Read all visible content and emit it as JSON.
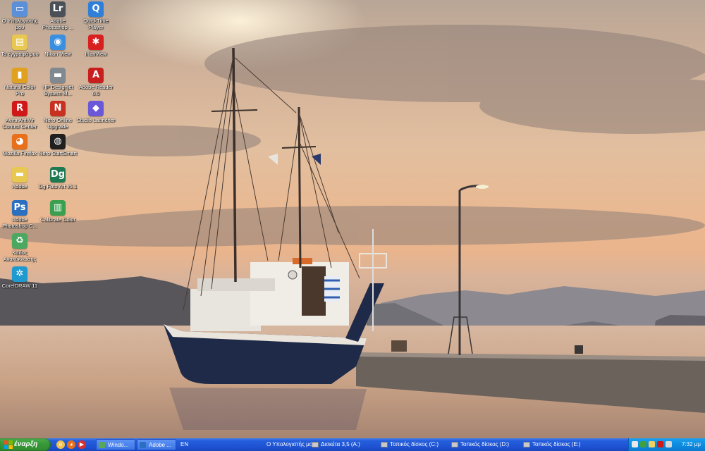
{
  "desktop": {
    "icons": [
      {
        "label": "Ο Υπολογιστής μου",
        "icon": "my-computer-icon",
        "color": "#5b8fd8",
        "glyph": "▭"
      },
      {
        "label": "Adobe Photoshop ...",
        "icon": "lightroom-icon",
        "color": "#4a5058",
        "glyph": "Lr"
      },
      {
        "label": "QuickTime Player",
        "icon": "quicktime-icon",
        "color": "#2f7fd9",
        "glyph": "Q"
      },
      {
        "label": "Τα έγγραφά μου",
        "icon": "my-documents-icon",
        "color": "#e8c850",
        "glyph": "▤"
      },
      {
        "label": "Nikon View",
        "icon": "nikon-view-icon",
        "color": "#3b8fe0",
        "glyph": "◉"
      },
      {
        "label": "IrfanView",
        "icon": "irfanview-icon",
        "color": "#d82020",
        "glyph": "✱"
      },
      {
        "label": "Natural Color Pro",
        "icon": "natural-color-pro-icon",
        "color": "#e0a020",
        "glyph": "▮"
      },
      {
        "label": "HP Designjet System M...",
        "icon": "hp-designjet-icon",
        "color": "#808890",
        "glyph": "▬"
      },
      {
        "label": "Adobe Reader 6.0",
        "icon": "adobe-reader-icon",
        "color": "#c81e1e",
        "glyph": "A"
      },
      {
        "label": "Avira AntiVir Control Center",
        "icon": "avira-icon",
        "color": "#d01818",
        "glyph": "R"
      },
      {
        "label": "Nero Online Upgrade",
        "icon": "nero-upgrade-icon",
        "color": "#c83020",
        "glyph": "N"
      },
      {
        "label": "Studio Launcher",
        "icon": "studio-launcher-icon",
        "color": "#6a58d8",
        "glyph": "◆"
      },
      {
        "label": "Mozilla Firefox",
        "icon": "firefox-icon",
        "color": "#e8701a",
        "glyph": "◕"
      },
      {
        "label": "Nero StartSmart",
        "icon": "nero-startsmart-icon",
        "color": "#202020",
        "glyph": "◍"
      },
      {
        "label": "Adobe",
        "icon": "folder-icon",
        "color": "#e8c850",
        "glyph": "▬"
      },
      {
        "label": "Dg Foto Art v5.1",
        "icon": "dg-foto-art-icon",
        "color": "#1e7a52",
        "glyph": "Dg"
      },
      {
        "label": "Adobe Photoshop C...",
        "icon": "photoshop-icon",
        "color": "#2a6fc0",
        "glyph": "Ps"
      },
      {
        "label": "Calibrate Color",
        "icon": "calibrate-color-icon",
        "color": "#3aa050",
        "glyph": "▥"
      },
      {
        "label": "Κάδος Ανακύκλωσης",
        "icon": "recycle-bin-icon",
        "color": "#4aa860",
        "glyph": "♻"
      },
      {
        "label": "CorelDRAW 11",
        "icon": "coreldraw-icon",
        "color": "#1e9ad0",
        "glyph": "✲"
      }
    ]
  },
  "taskbar": {
    "start_label": "έναρξη",
    "quick_launch": [
      {
        "icon": "ie-icon",
        "color": "#f2c14e",
        "glyph": "e"
      },
      {
        "icon": "firefox-quicklaunch-icon",
        "color": "#e8701a",
        "glyph": "◕"
      },
      {
        "icon": "media-icon",
        "color": "#d83030",
        "glyph": "▶"
      }
    ],
    "windows": [
      {
        "label": "Windo...",
        "icon": "explorer-window-icon",
        "color": "#58a858"
      },
      {
        "label": "Adobe ...",
        "icon": "adobe-window-icon",
        "color": "#2a6fc0"
      }
    ],
    "language": "EN",
    "drives": [
      {
        "label": "Ο Υπολογιστής μου"
      },
      {
        "label": "Δισκέτα 3,5 (A:)"
      },
      {
        "label": "Τοπικός δίσκος (C:)"
      },
      {
        "label": "Τοπικός δίσκος (D:)"
      },
      {
        "label": "Τοπικός δίσκος (E:)"
      }
    ],
    "tray_icons": [
      {
        "icon": "network-icon",
        "color": "#e8e8e8"
      },
      {
        "icon": "update-icon",
        "color": "#40a040"
      },
      {
        "icon": "volume-icon",
        "color": "#f0d060"
      },
      {
        "icon": "antivir-tray-icon",
        "color": "#d01818"
      },
      {
        "icon": "security-icon",
        "color": "#d8d8d8"
      }
    ],
    "clock": "7:32 μμ"
  }
}
